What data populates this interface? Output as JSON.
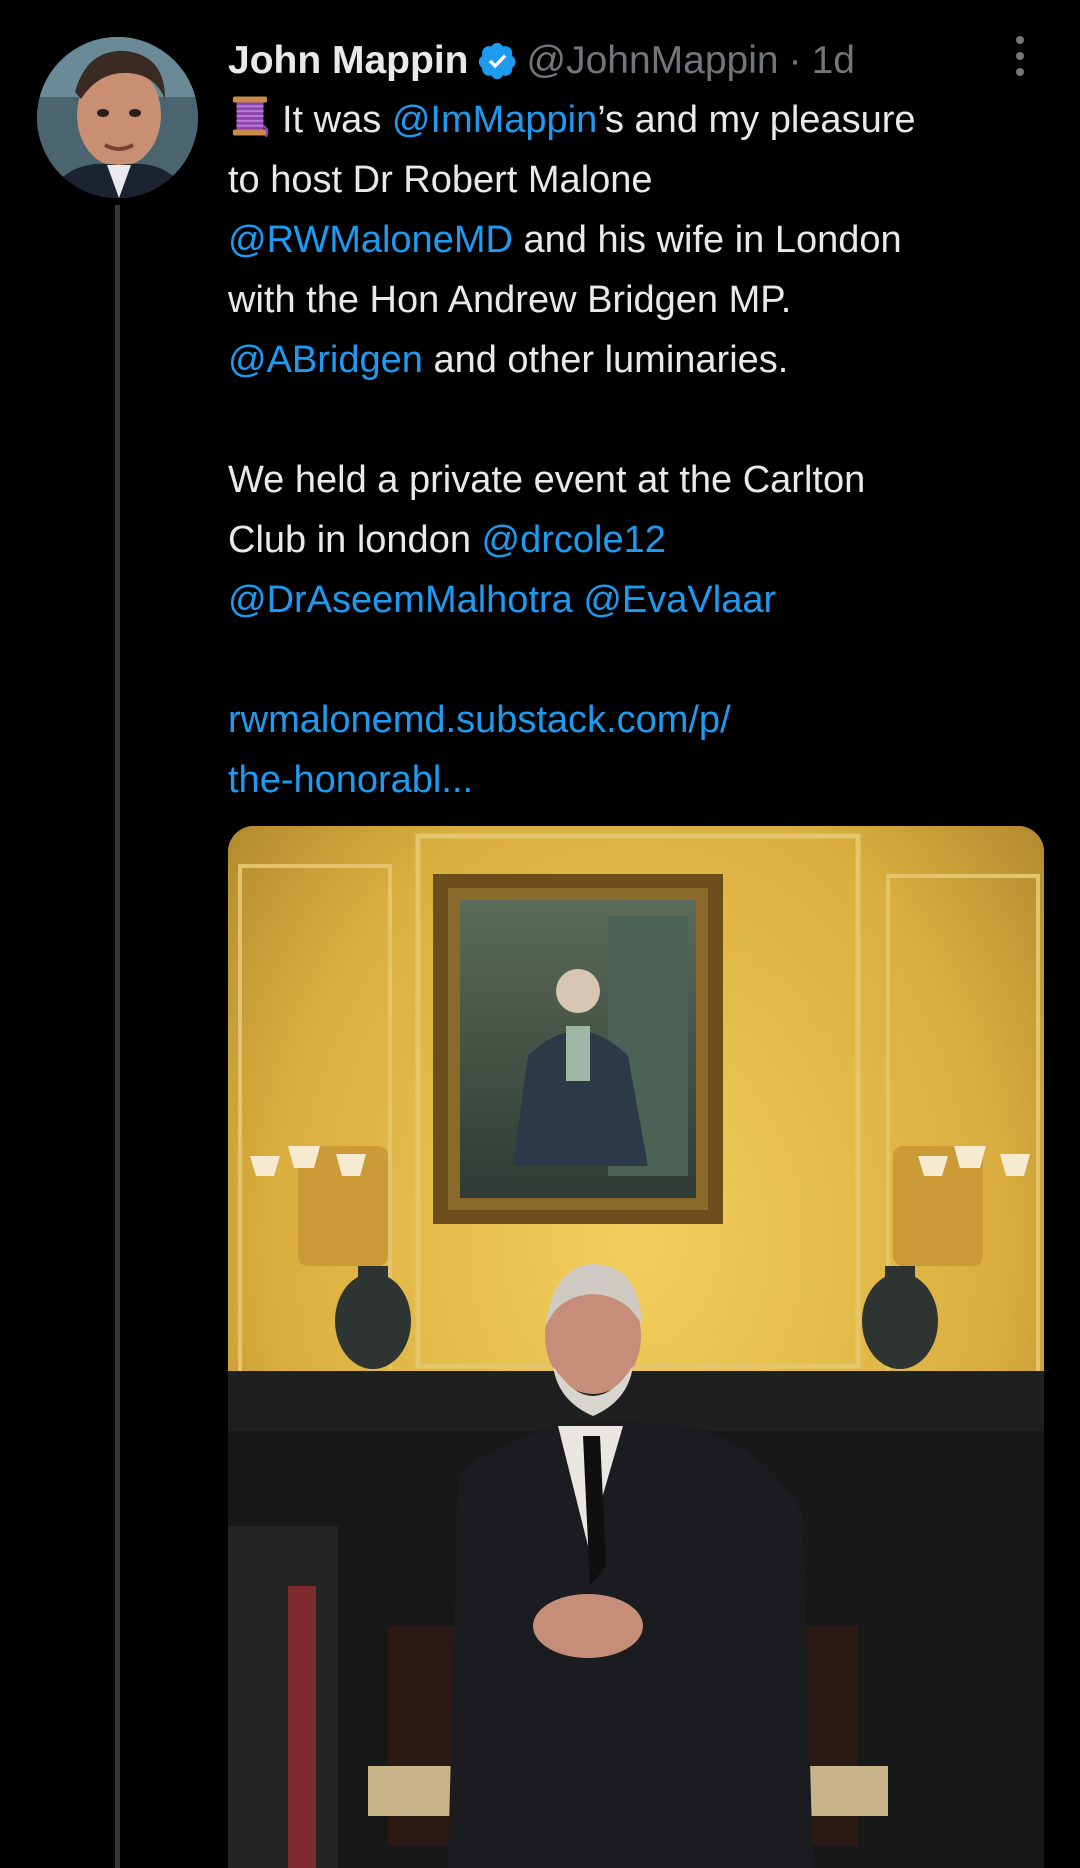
{
  "author": {
    "display_name": "John Mappin",
    "handle": "@JohnMappin",
    "separator": "·",
    "time": "1d",
    "verified_icon": "verified-badge-icon"
  },
  "tweet": {
    "emoji": "spool-of-thread",
    "line1_pre": "It was ",
    "line1_mention": "@ImMappin",
    "line1_post": "’s and my pleasure",
    "line2": "to host Dr Robert Malone",
    "line3_mention": "@RWMaloneMD",
    "line3_post": " and his wife in London",
    "line4": "with the Hon Andrew Bridgen MP.",
    "line5_mention": "@ABridgen",
    "line5_post": " and other luminaries.",
    "line7": "We held a private event at the Carlton",
    "line8_pre": "Club in london ",
    "line8_mention": "@drcole12",
    "line9_mention1": "@DrAseemMalhotra",
    "line9_mention2": "@EvaVlaar",
    "link_line1": "rwmalonemd.substack.com/p/",
    "link_line2": "the-honorabl..."
  },
  "colors": {
    "background": "#000000",
    "text": "#e7e9ea",
    "secondary": "#71767b",
    "link": "#1d9bf0",
    "thread_line": "#333639"
  },
  "media": {
    "kind": "photo"
  }
}
